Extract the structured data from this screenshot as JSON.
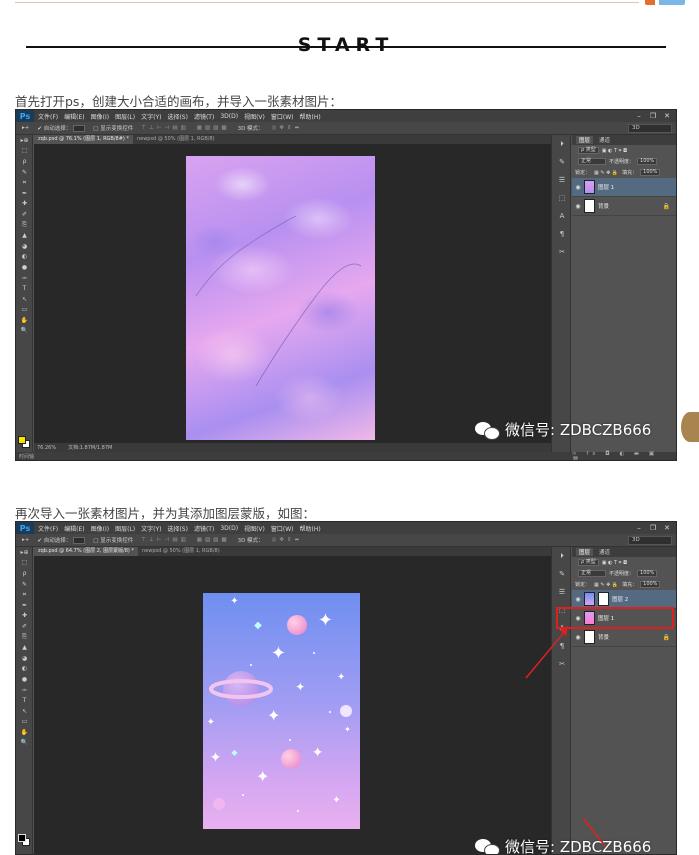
{
  "header": {
    "start_text": "START"
  },
  "captions": {
    "step1": "首先打开ps，创建大小合适的画布，并导入一张素材图片：",
    "step2": "再次导入一张素材图片，并为其添加图层蒙版，如图："
  },
  "watermark": {
    "text": "微信号: ZDBCZB666"
  },
  "colors": {
    "ps_bg": "#535353",
    "ps_dark": "#282828",
    "highlight_red": "#e02020",
    "selected_layer": "#546a80"
  },
  "ps": {
    "app_logo": "Ps",
    "menu": [
      "文件(F)",
      "编辑(E)",
      "图像(I)",
      "图层(L)",
      "文字(Y)",
      "选择(S)",
      "滤镜(T)",
      "3D(D)",
      "视图(V)",
      "窗口(W)",
      "帮助(H)"
    ],
    "window_controls": [
      "–",
      "❐",
      "✕"
    ],
    "options": {
      "auto_select": "自动选择：",
      "show_transform": "显示变换控件",
      "mode_3d": "3D 模式：",
      "workspace": "3D"
    },
    "layers_tabs": [
      "图层",
      "通道"
    ],
    "kind_label": "ρ 类型",
    "blend_mode": "正常",
    "opacity_label": "不透明度：",
    "opacity_value": "100%",
    "lock_label": "锁定：",
    "fill_label": "填充：",
    "fill_value": "100%",
    "layers_footer": "∞ fx ◘ ◐ ▬ ▣ 🗑",
    "tools": [
      "▸⊕",
      "⬚",
      "ρ",
      "✎",
      "⌗",
      "✒",
      "✚",
      "✐",
      "⎘",
      "▲",
      "◕",
      "◐",
      "●",
      "✑",
      "T",
      "↖",
      "▭",
      "✋",
      "🔍"
    ]
  },
  "screens": [
    {
      "tabs": [
        "zqb.psd @ 76.1% (图层 1, RGB/8#) *",
        "newpsd @ 50% (图层 1, RGB/8)"
      ],
      "status_zoom": "76.26%",
      "status_doc": "文档:1.87M/1.87M",
      "bottom_label": "时间轴",
      "layers": [
        {
          "name": "图层 1",
          "selected": true,
          "mask": false
        },
        {
          "name": "背景",
          "selected": false,
          "mask": false,
          "locked": true
        }
      ]
    },
    {
      "tabs": [
        "zqb.psd @ 64.7% (图层 2, 图层蒙版/8) *",
        "newpsd @ 50% (图层 1, RGB/8)"
      ],
      "status_zoom": "",
      "status_doc": "",
      "bottom_label": "",
      "layers": [
        {
          "name": "图层 2",
          "selected": true,
          "mask": true
        },
        {
          "name": "图层 1",
          "selected": false,
          "mask": false
        },
        {
          "name": "背景",
          "selected": false,
          "mask": false,
          "locked": true
        }
      ]
    }
  ]
}
